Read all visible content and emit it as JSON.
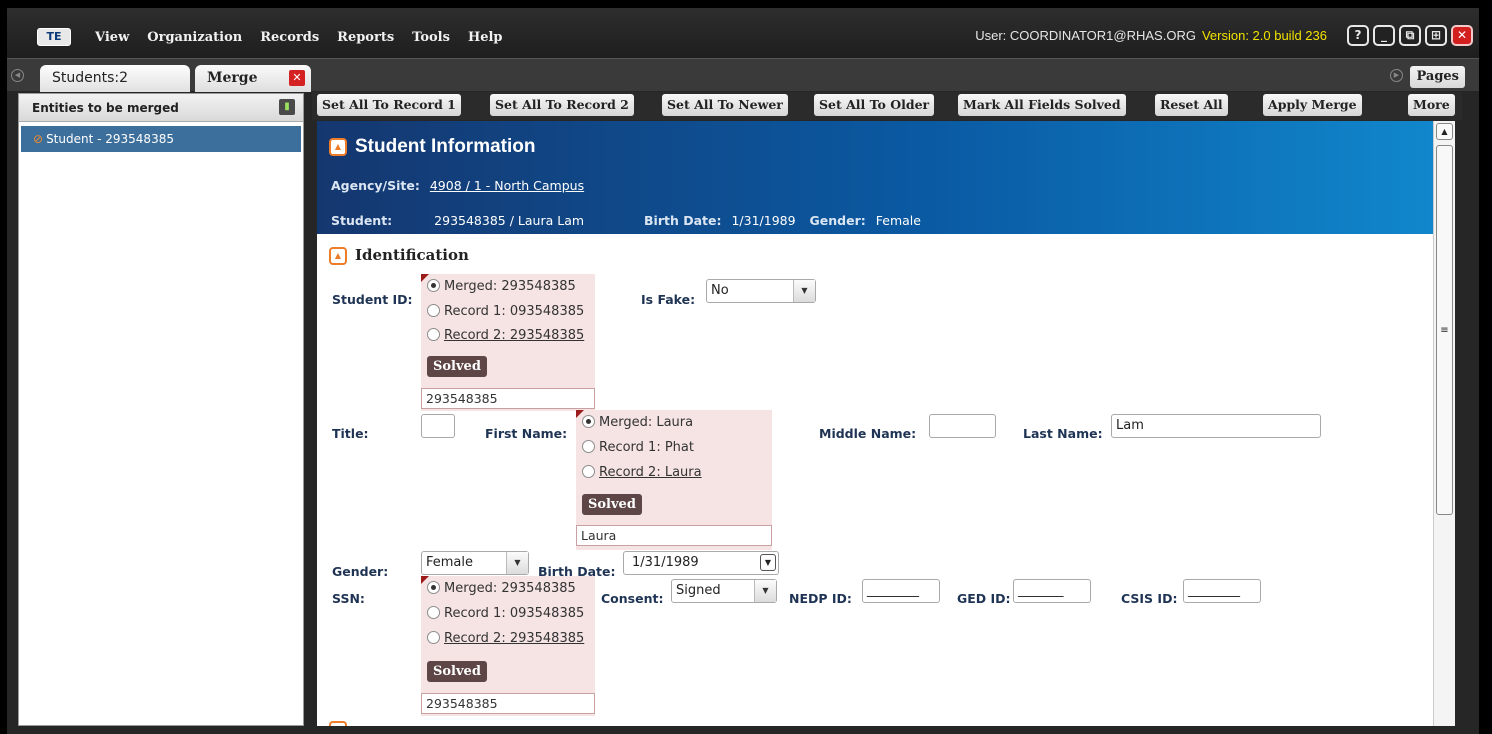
{
  "app": {
    "logo": "TE",
    "menu": [
      "View",
      "Organization",
      "Records",
      "Reports",
      "Tools",
      "Help"
    ],
    "user": "User: COORDINATOR1@RHAS.ORG",
    "version": "Version: 2.0 build 236",
    "window_buttons": {
      "help": "?",
      "minimize": "_",
      "restore": "⧉",
      "maximize": "⊞",
      "close": "✕"
    }
  },
  "tabs": {
    "students": "Students:2",
    "merge": "Merge",
    "close": "✕",
    "pages": "Pages"
  },
  "left_panel": {
    "title": "Entities to be merged",
    "pin": "▮",
    "items": [
      {
        "label": "Student - 293548385"
      }
    ]
  },
  "toolbar": {
    "set_all_record1": "Set All To Record 1",
    "set_all_record2": "Set All To Record 2",
    "set_all_newer": "Set All To Newer",
    "set_all_older": "Set All To Older",
    "mark_all_solved": "Mark All Fields Solved",
    "reset_all": "Reset All",
    "apply_merge": "Apply Merge",
    "more": "More"
  },
  "student_info": {
    "title": "Student Information",
    "agency_label": "Agency/Site:",
    "agency_value": "4908 / 1 - North Campus",
    "student_label": "Student:",
    "student_value": "293548385 / Laura Lam",
    "birth_label": "Birth Date:",
    "birth_value": "1/31/1989",
    "gender_label": "Gender:",
    "gender_value": "Female"
  },
  "identification": {
    "title": "Identification",
    "student_id": {
      "label": "Student ID:",
      "merged": "Merged: 293548385",
      "record1": "Record 1: 093548385",
      "record2": "Record 2: 293548385",
      "solved": "Solved",
      "value": "293548385"
    },
    "is_fake": {
      "label": "Is Fake:",
      "value": "No"
    },
    "title_field": {
      "label": "Title:",
      "value": ""
    },
    "first_name": {
      "label": "First Name:",
      "merged": "Merged: Laura",
      "record1": "Record 1: Phat",
      "record2": "Record 2: Laura",
      "solved": "Solved",
      "value": "Laura"
    },
    "middle_name": {
      "label": "Middle Name:",
      "value": ""
    },
    "last_name": {
      "label": "Last Name:",
      "value": "Lam"
    },
    "gender": {
      "label": "Gender:",
      "value": "Female"
    },
    "birth_date": {
      "label": "Birth Date:",
      "value": "1/31/1989"
    },
    "ssn": {
      "label": "SSN:",
      "merged": "Merged: 293548385",
      "record1": "Record 1: 093548385",
      "record2": "Record 2: 293548385",
      "solved": "Solved",
      "value": "293548385"
    },
    "consent": {
      "label": "Consent:",
      "value": "Signed"
    },
    "nedp_id": {
      "label": "NEDP ID:",
      "value": "________"
    },
    "ged_id": {
      "label": "GED ID:",
      "value": "_______"
    },
    "csis_id": {
      "label": "CSIS ID:",
      "value": "________"
    }
  }
}
